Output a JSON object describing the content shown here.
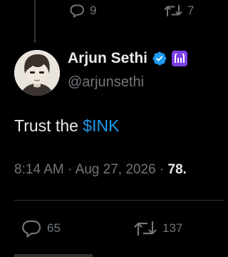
{
  "previous_tweet": {
    "reply_count": "9",
    "retweet_count": "7"
  },
  "tweet": {
    "author": {
      "display_name": "Arjun Sethi",
      "handle": "@arjunsethi",
      "verified_color": "#1d9bf0",
      "affiliate_badge_color": "#7b3fe4"
    },
    "text_prefix": "Trust the ",
    "cashtag": "$INK",
    "time": "8:14 AM",
    "date": "Aug 27, 2026",
    "views": "78.",
    "reply_count": "65",
    "retweet_count": "137"
  },
  "icons": {
    "reply": "reply-icon",
    "retweet": "retweet-icon",
    "verified": "verified-badge-icon",
    "affiliate": "affiliate-badge-icon"
  },
  "colors": {
    "background": "#000000",
    "text": "#e7e9ea",
    "secondary": "#71767b",
    "link": "#1d9bf0"
  }
}
